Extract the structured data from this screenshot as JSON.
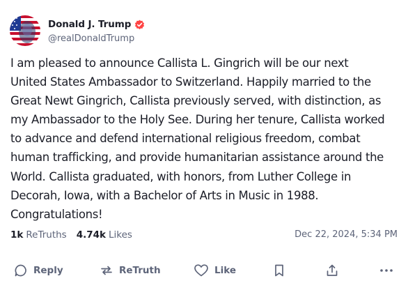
{
  "post": {
    "author": {
      "display_name": "Donald J. Trump",
      "handle": "@realDonaldTrump",
      "verified_badge": "verified-check-icon",
      "badge_color": "#ff4444"
    },
    "text_lines": [
      "I am pleased to announce Callista L. Gingrich will be our next",
      "United States Ambassador to Switzerland. Happily married to the",
      "Great Newt Gingrich, Callista previously served, with distinction, as",
      "my Ambassador to the Holy See. During her tenure, Callista worked",
      "to advance and defend international religious freedom, combat",
      "human trafficking, and provide humanitarian assistance around the",
      "World. Callista graduated, with honors, from Luther College in",
      "Decorah, Iowa, with a Bachelor of Arts in Music in 1988.",
      "Congratulations!"
    ],
    "stats": {
      "retruths_count": "1k",
      "retruths_label": "ReTruths",
      "likes_count": "4.74k",
      "likes_label": "Likes"
    },
    "timestamp": "Dec 22, 2024, 5:34 PM"
  },
  "actions": {
    "reply_label": "Reply",
    "retruth_label": "ReTruth",
    "like_label": "Like",
    "icons": [
      "reply-icon",
      "retruth-icon",
      "like-icon",
      "bookmark-icon",
      "share-icon",
      "more-icon"
    ],
    "icon_color": "#5d6479"
  }
}
